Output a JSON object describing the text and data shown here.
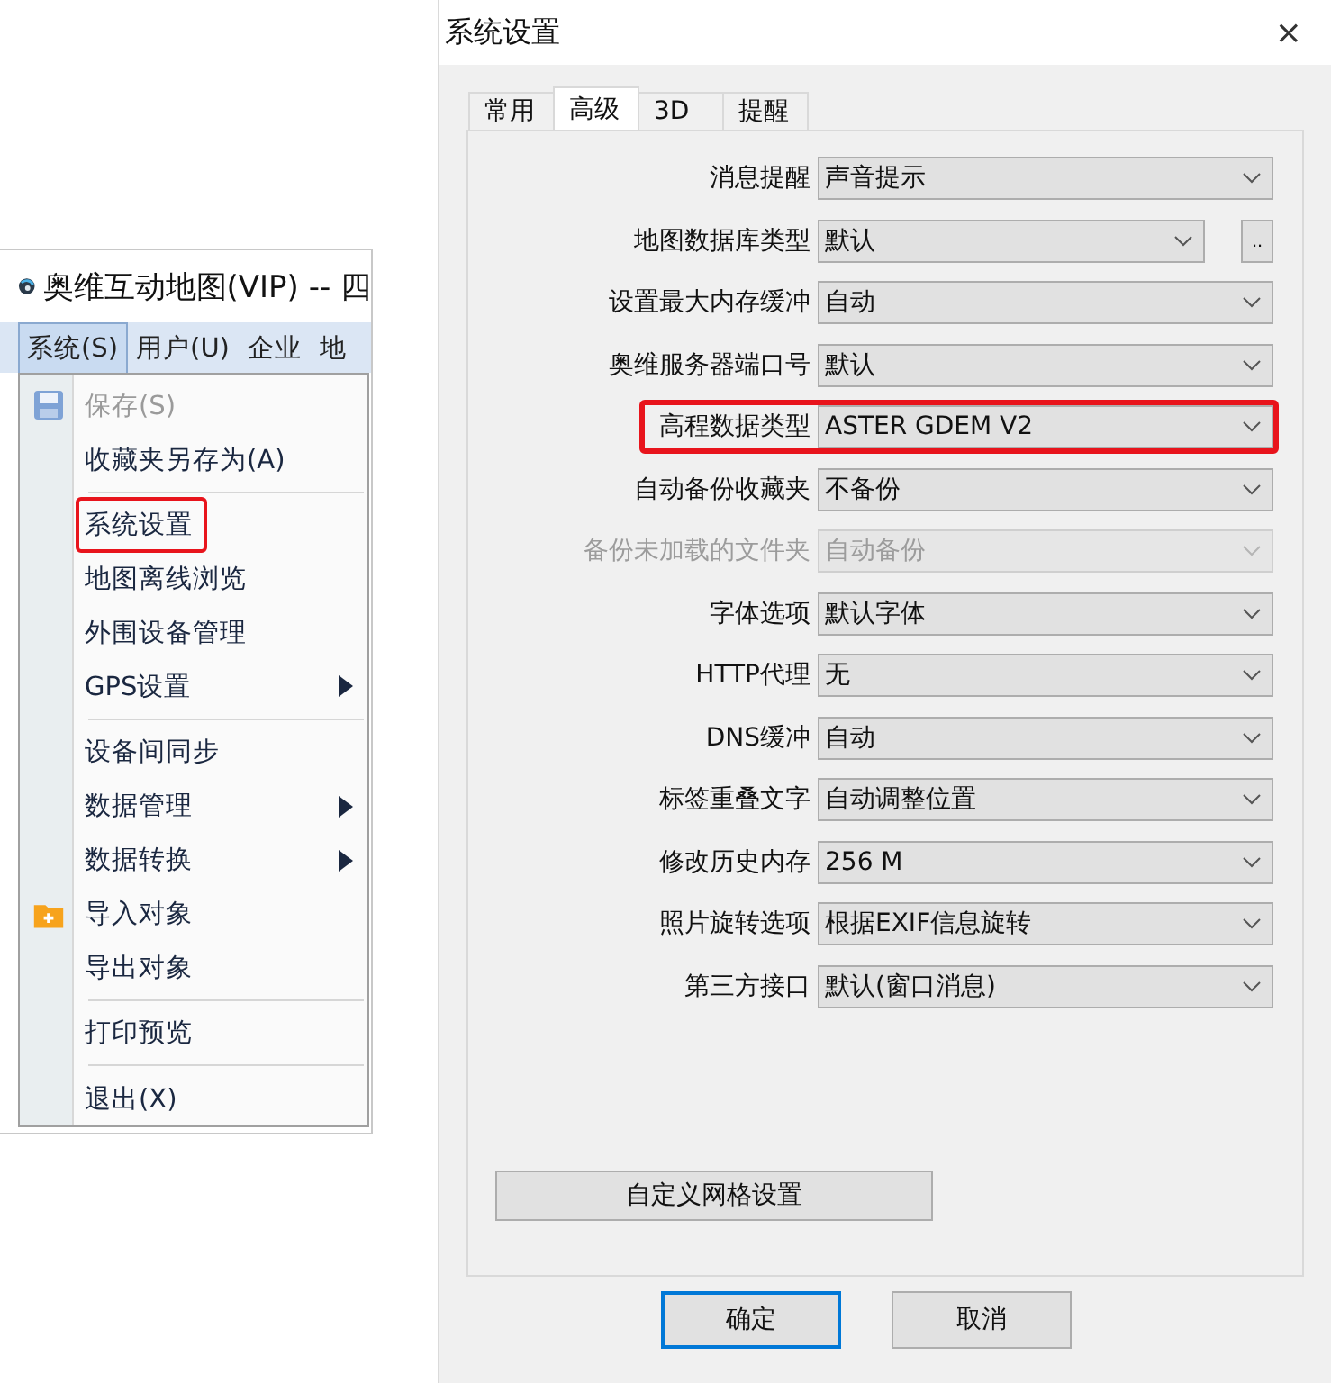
{
  "app": {
    "title": "奥维互动地图(VIP) -- 四",
    "menubar": [
      {
        "label": "系统(S)",
        "selected": true
      },
      {
        "label": "用户(U)",
        "selected": false
      },
      {
        "label": "企业",
        "selected": false
      },
      {
        "label": "地",
        "selected": false
      }
    ],
    "menu": [
      {
        "kind": "floppy_item",
        "label": "保存(S)",
        "disabled": true,
        "submenu": false,
        "highlighted": false
      },
      {
        "kind": "item",
        "label": "收藏夹另存为(A)",
        "disabled": false,
        "submenu": false,
        "highlighted": false
      },
      {
        "kind": "separator"
      },
      {
        "kind": "item",
        "label": "系统设置",
        "disabled": false,
        "submenu": false,
        "highlighted": true
      },
      {
        "kind": "item",
        "label": "地图离线浏览",
        "disabled": false,
        "submenu": false,
        "highlighted": false
      },
      {
        "kind": "item",
        "label": "外围设备管理",
        "disabled": false,
        "submenu": false,
        "highlighted": false
      },
      {
        "kind": "item",
        "label": "GPS设置",
        "disabled": false,
        "submenu": true,
        "highlighted": false
      },
      {
        "kind": "separator"
      },
      {
        "kind": "item",
        "label": "设备间同步",
        "disabled": false,
        "submenu": false,
        "highlighted": false
      },
      {
        "kind": "item",
        "label": "数据管理",
        "disabled": false,
        "submenu": true,
        "highlighted": false
      },
      {
        "kind": "item",
        "label": "数据转换",
        "disabled": false,
        "submenu": true,
        "highlighted": false
      },
      {
        "kind": "folder_item",
        "label": "导入对象",
        "disabled": false,
        "submenu": false,
        "highlighted": false
      },
      {
        "kind": "item",
        "label": "导出对象",
        "disabled": false,
        "submenu": false,
        "highlighted": false
      },
      {
        "kind": "separator"
      },
      {
        "kind": "item",
        "label": "打印预览",
        "disabled": false,
        "submenu": false,
        "highlighted": false
      },
      {
        "kind": "separator"
      },
      {
        "kind": "item",
        "label": "退出(X)",
        "disabled": false,
        "submenu": false,
        "highlighted": false
      }
    ]
  },
  "dialog": {
    "title": "系统设置",
    "close": "×",
    "tabs": [
      {
        "label": "常用",
        "selected": false
      },
      {
        "label": "高级",
        "selected": true
      },
      {
        "label": "3D",
        "selected": false
      },
      {
        "label": "提醒",
        "selected": false
      }
    ],
    "settings": [
      {
        "label": "消息提醒",
        "value": "声音提示",
        "disabled": false,
        "highlighted": false
      },
      {
        "label": "地图数据库类型",
        "value": "默认",
        "disabled": false,
        "highlighted": false,
        "extra_button": ".."
      },
      {
        "label": "设置最大内存缓冲",
        "value": "自动",
        "disabled": false,
        "highlighted": false
      },
      {
        "label": "奥维服务器端口号",
        "value": "默认",
        "disabled": false,
        "highlighted": false
      },
      {
        "label": "高程数据类型",
        "value": "ASTER GDEM V2",
        "disabled": false,
        "highlighted": true
      },
      {
        "label": "自动备份收藏夹",
        "value": "不备份",
        "disabled": false,
        "highlighted": false
      },
      {
        "label": "备份未加载的文件夹",
        "value": "自动备份",
        "disabled": true,
        "highlighted": false
      },
      {
        "label": "字体选项",
        "value": "默认字体",
        "disabled": false,
        "highlighted": false
      },
      {
        "label": "HTTP代理",
        "value": "无",
        "disabled": false,
        "highlighted": false
      },
      {
        "label": "DNS缓冲",
        "value": "自动",
        "disabled": false,
        "highlighted": false
      },
      {
        "label": "标签重叠文字",
        "value": "自动调整位置",
        "disabled": false,
        "highlighted": false
      },
      {
        "label": "修改历史内存",
        "value": "256 M",
        "disabled": false,
        "highlighted": false
      },
      {
        "label": "照片旋转选项",
        "value": "根据EXIF信息旋转",
        "disabled": false,
        "highlighted": false
      },
      {
        "label": "第三方接口",
        "value": "默认(窗口消息)",
        "disabled": false,
        "highlighted": false
      }
    ],
    "grid_button": "自定义网格设置",
    "buttons": [
      {
        "label": "确定",
        "default": true
      },
      {
        "label": "取消",
        "default": false
      }
    ]
  }
}
